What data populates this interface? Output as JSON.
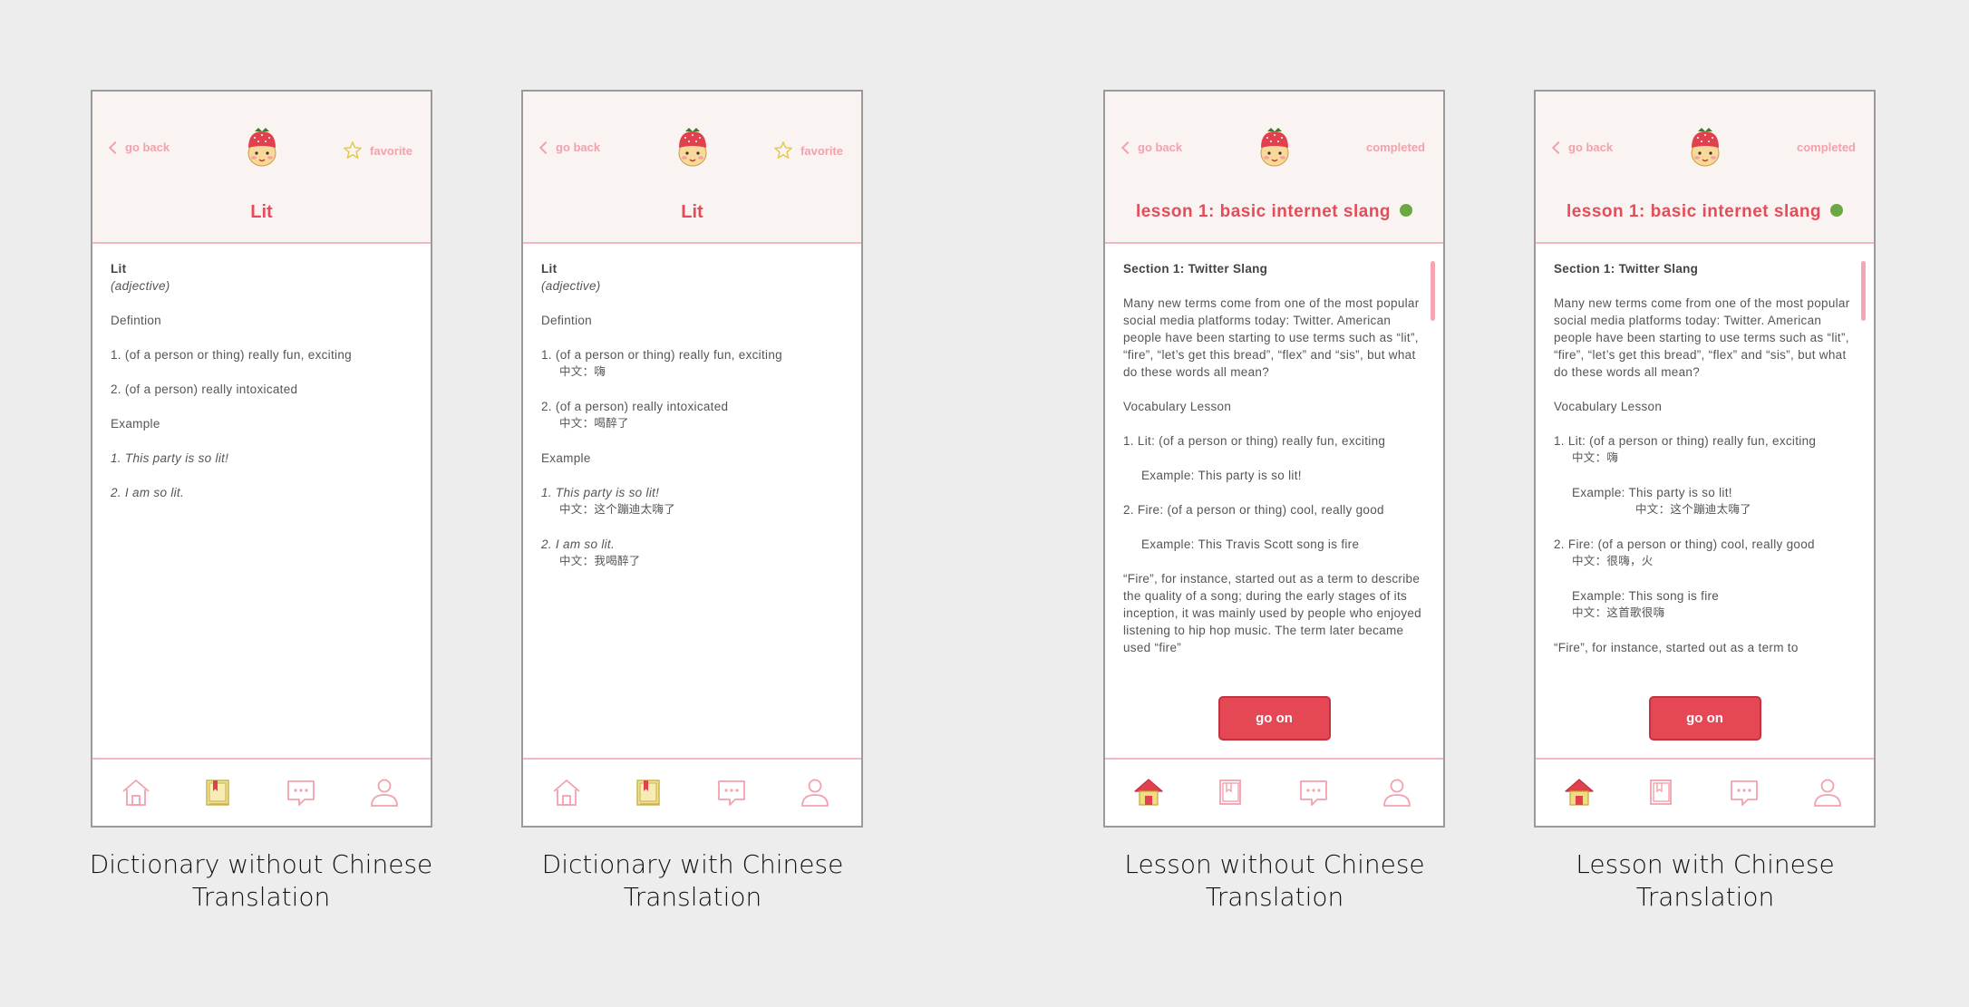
{
  "colors": {
    "accent": "#e64b5a",
    "pink": "#f2a1ad",
    "header_bg": "#f9f4f2",
    "check": "#6ca842"
  },
  "header": {
    "back": "go back",
    "favorite": "favorite",
    "completed": "completed"
  },
  "dict": {
    "title": "Lit",
    "word": "Lit",
    "pos": "(adjective)",
    "definition_label": "Defintion",
    "def1": "1. (of a person or thing) really fun, exciting",
    "def2": "2. (of a person) really intoxicated",
    "example_label": "Example",
    "ex1": "1. This party is so lit!",
    "ex2": "2. I am so lit.",
    "def1_zh": "中文：嗨",
    "def2_zh": "中文：喝醉了",
    "ex1_zh": "中文：这个蹦迪太嗨了",
    "ex2_zh": "中文：我喝醉了"
  },
  "lesson": {
    "title": "lesson 1: basic internet slang",
    "section": "Section 1: Twitter Slang",
    "intro": "Many new terms come from one of the most popular social media platforms today: Twitter. American people have been starting to use terms such as “lit”, “fire”, “let’s get this bread”, “flex” and “sis”, but what do these words all mean?",
    "vocab_label": "Vocabulary Lesson",
    "item1": "1. Lit: (of a person or thing) really fun, exciting",
    "item1_ex": "Example: This party is so lit!",
    "item2": "2. Fire: (of a person or thing) cool, really good",
    "item2_ex": "Example: This Travis Scott song is fire",
    "item2_ex_zh_version": "Example: This song is fire",
    "para": "“Fire”, for instance, started out as a term to describe the quality of a song; during the early stages of its inception, it was mainly used by people who enjoyed listening to hip hop music. The term later became used “fire”",
    "para_zh_version": "“Fire”, for instance, started out as a term to",
    "item1_zh": "中文：嗨",
    "item1_ex_zh": "中文：这个蹦迪太嗨了",
    "item2_zh": "中文：很嗨，火",
    "item2_ex_zh": "中文：这首歌很嗨",
    "button": "go on"
  },
  "captions": {
    "c1": "Dictionary without Chinese Translation",
    "c2": "Dictionary with Chinese Translation",
    "c3": "Lesson without Chinese Translation",
    "c4": "Lesson with Chinese Translation"
  },
  "icons": [
    "home-icon",
    "dictionary-book-icon",
    "chat-bubble-icon",
    "profile-icon",
    "star-icon",
    "back-chevron-icon",
    "strawberry-mascot-icon",
    "check-icon"
  ]
}
